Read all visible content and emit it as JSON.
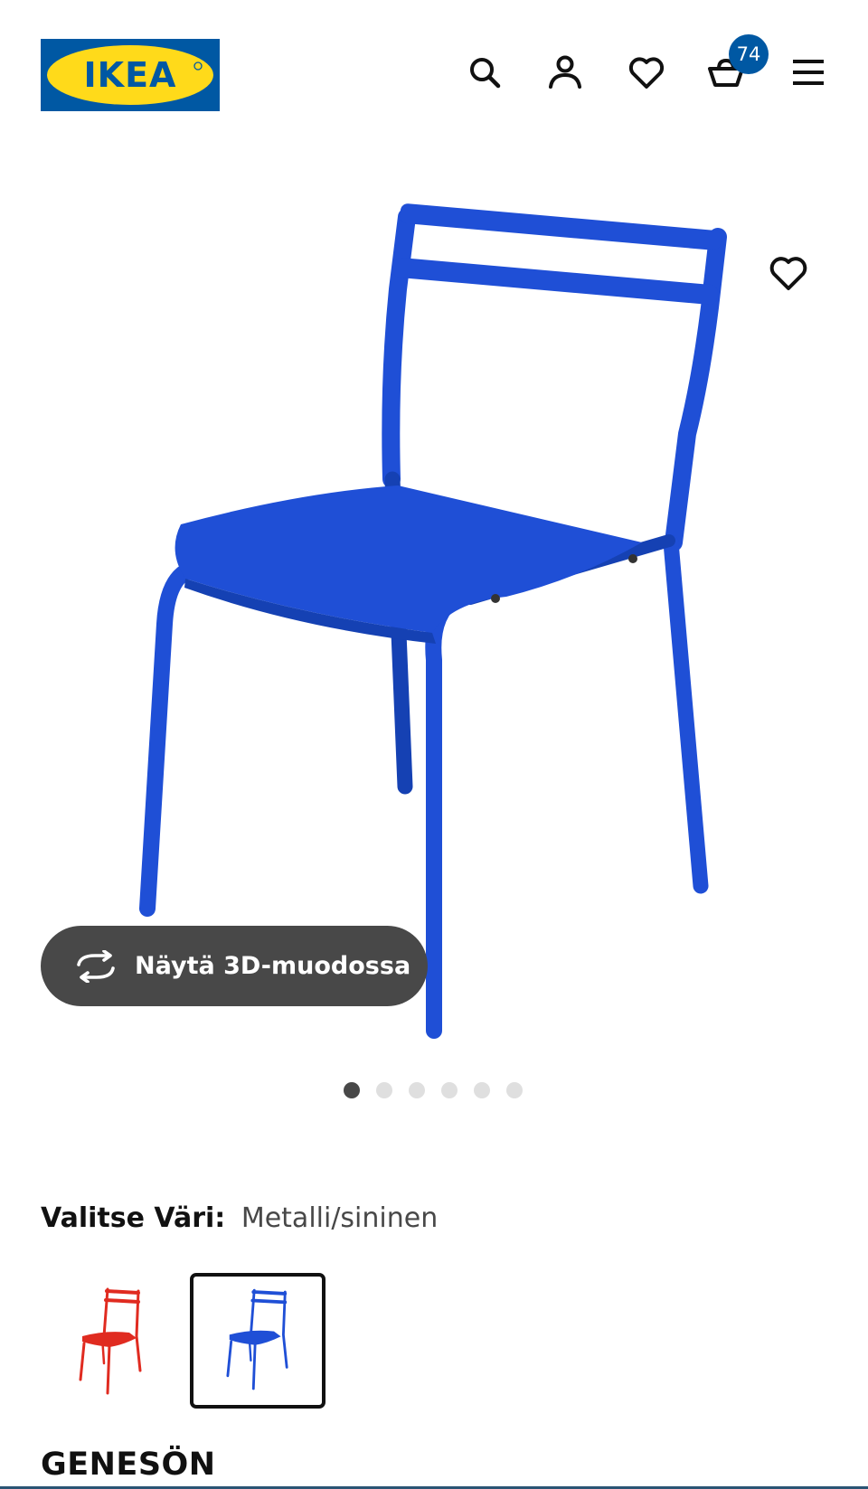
{
  "header": {
    "logo_text": "IKEA",
    "icons": [
      "search-icon",
      "account-icon",
      "heart-icon",
      "cart-icon",
      "menu-icon"
    ],
    "cart_count": "74"
  },
  "gallery": {
    "view_3d_label": "Näytä 3D-muodossa",
    "dots": [
      {
        "active": true
      },
      {
        "active": false
      },
      {
        "active": false
      },
      {
        "active": false
      },
      {
        "active": false
      },
      {
        "active": false
      }
    ]
  },
  "color_select": {
    "label": "Valitse Väri:",
    "value": "Metalli/sininen",
    "swatches": [
      {
        "color": "#e02b20",
        "selected": false
      },
      {
        "color": "#1f4fd6",
        "selected": true
      }
    ]
  },
  "product": {
    "name": "GENESÖN"
  },
  "colors": {
    "brand_blue": "#0058a3",
    "brand_yellow": "#ffda1a",
    "chair_blue": "#1f4fd6",
    "dark_gray": "#484848"
  }
}
